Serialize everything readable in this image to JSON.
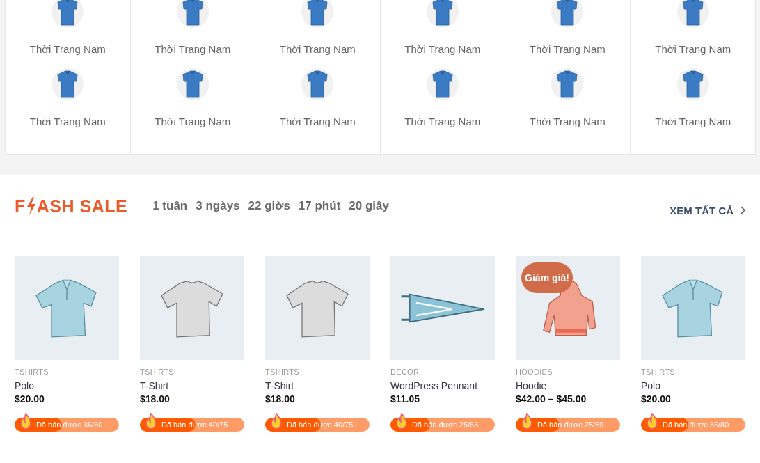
{
  "categories": [
    {
      "label": "Thời Trang Nam"
    },
    {
      "label": "Thời Trang Nam"
    },
    {
      "label": "Thời Trang Nam"
    },
    {
      "label": "Thời Trang Nam"
    },
    {
      "label": "Thời Trang Nam"
    },
    {
      "label": "Thời Trang Nam"
    },
    {
      "label": "Thời Trang Nam"
    },
    {
      "label": "Thời Trang Nam"
    },
    {
      "label": "Thời Trang Nam"
    },
    {
      "label": "Thời Trang Nam"
    },
    {
      "label": "Thời Trang Nam"
    },
    {
      "label": "Thời Trang Nam"
    }
  ],
  "flash_sale": {
    "title_parts": [
      "F",
      "ASH SALE"
    ],
    "countdown": [
      "1 tuần",
      "3 ngàys",
      "22 giờs",
      "17 phút",
      "20 giây"
    ],
    "view_all": "XEM TẤT CẢ",
    "products": [
      {
        "kind": "polo",
        "category": "TSHIRTS",
        "name": "Polo",
        "price": "$20.00",
        "sold": "Đã bán được 36/80",
        "level": 0.45
      },
      {
        "kind": "tshirt",
        "category": "TSHIRTS",
        "name": "T-Shirt",
        "price": "$18.00",
        "sold": "Đã bán được 40/75",
        "level": 0.53
      },
      {
        "kind": "tshirt",
        "category": "TSHIRTS",
        "name": "T-Shirt",
        "price": "$18.00",
        "sold": "Đã bán được 40/75",
        "level": 0.53
      },
      {
        "kind": "pennant",
        "category": "DECOR",
        "name": "WordPress Pennant",
        "price": "$11.05",
        "sold": "Đã bán được 25/65",
        "level": 0.38
      },
      {
        "kind": "hoodie",
        "category": "HOODIES",
        "name": "Hoodie",
        "price": "$42.00 – $45.00",
        "sold": "Đã bán được 25/59",
        "level": 0.42,
        "badge": "Giảm giá!"
      },
      {
        "kind": "polo",
        "category": "TSHIRTS",
        "name": "Polo",
        "price": "$20.00",
        "sold": "Đã bán được 36/80",
        "level": 0.45
      }
    ]
  }
}
